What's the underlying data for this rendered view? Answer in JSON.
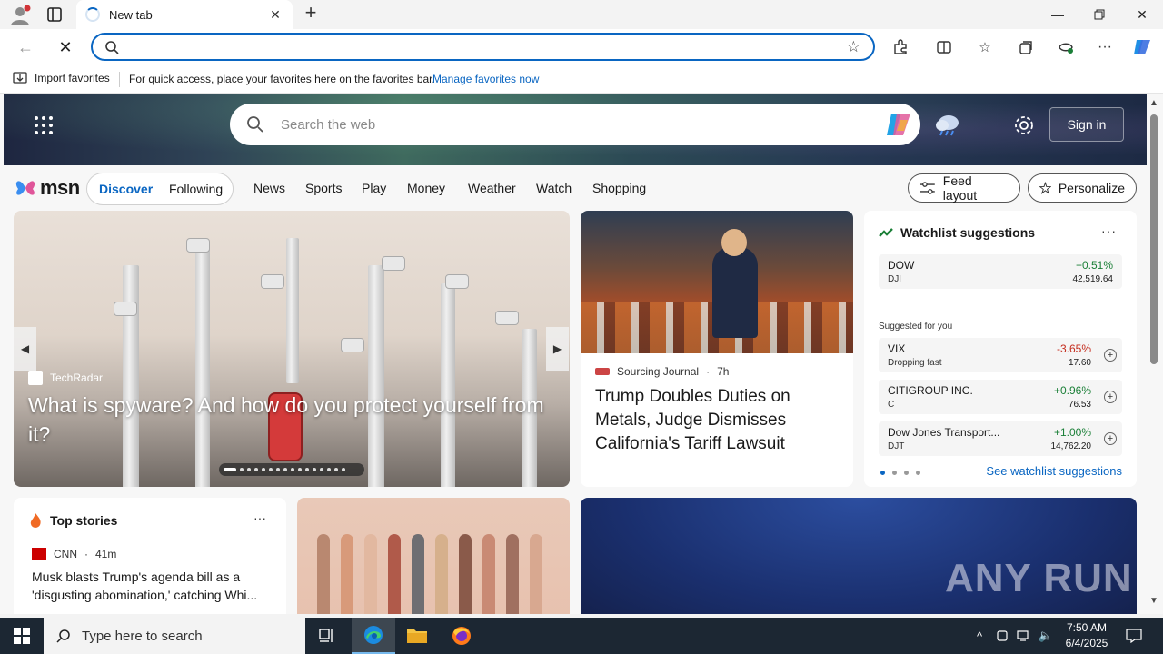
{
  "browser": {
    "tab_title": "New tab",
    "address_value": "",
    "address_placeholder": ""
  },
  "favorites_bar": {
    "import_label": "Import favorites",
    "hint": "For quick access, place your favorites here on the favorites bar.",
    "manage_link": "Manage favorites now"
  },
  "header": {
    "search_placeholder": "Search the web",
    "signin_label": "Sign in"
  },
  "msn_nav": {
    "logo_text": "msn",
    "discover": "Discover",
    "following": "Following",
    "links": [
      "News",
      "Sports",
      "Play",
      "Money",
      "Weather",
      "Watch",
      "Shopping"
    ],
    "feed_layout": "Feed layout",
    "personalize": "Personalize"
  },
  "hero": {
    "source": "TechRadar",
    "title": "What is spyware? And how do you protect yourself from it?",
    "slide_count": 16,
    "active_slide": 1
  },
  "news": {
    "source": "Sourcing Journal",
    "age": "7h",
    "title": "Trump Doubles Duties on Metals, Judge Dismisses California's Tariff Lawsuit"
  },
  "watchlist": {
    "title": "Watchlist suggestions",
    "more": "···",
    "suggested_label": "Suggested for you",
    "see_link": "See watchlist suggestions",
    "stocks": [
      {
        "name": "DOW",
        "symbol": "DJI",
        "change": "+0.51%",
        "price": "42,519.64",
        "dir": "up"
      },
      {
        "name": "VIX",
        "symbol": "Dropping fast",
        "change": "-3.65%",
        "price": "17.60",
        "dir": "down"
      },
      {
        "name": "CITIGROUP INC.",
        "symbol": "C",
        "change": "+0.96%",
        "price": "76.53",
        "dir": "up"
      },
      {
        "name": "Dow Jones Transport...",
        "symbol": "DJT",
        "change": "+1.00%",
        "price": "14,762.20",
        "dir": "up"
      }
    ]
  },
  "top_stories": {
    "title": "Top stories",
    "more": "···",
    "source": "CNN",
    "age": "41m",
    "headline": "Musk blasts Trump's agenda bill as a 'disgusting abomination,' catching Whi..."
  },
  "watermark": "ANY RUN",
  "taskbar": {
    "search_placeholder": "Type here to search",
    "time": "7:50 AM",
    "date": "6/4/2025"
  },
  "colors": {
    "accent": "#0a66c2",
    "up": "#1a7f37",
    "down": "#c42b1c",
    "taskbar": "#1c2733"
  }
}
